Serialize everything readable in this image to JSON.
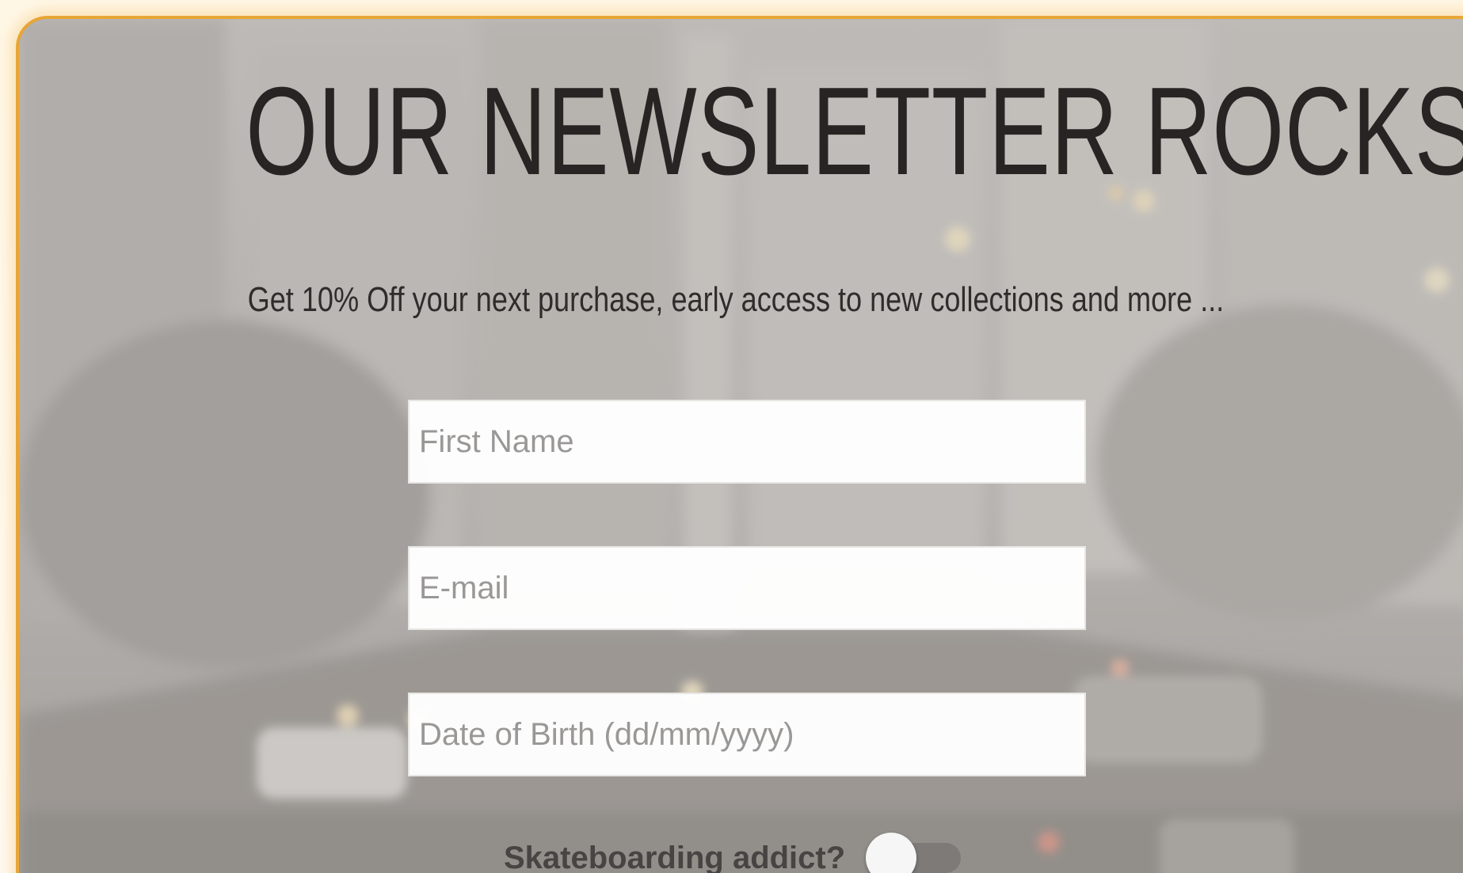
{
  "newsletter": {
    "headline": "OUR NEWSLETTER ROCKS!",
    "subtitle": "Get 10% Off your next purchase, early access to new collections and more ...",
    "fields": {
      "first_name_placeholder": "First Name",
      "email_placeholder": "E-mail",
      "dob_placeholder": "Date of Birth (dd/mm/yyyy)"
    },
    "toggle": {
      "label": "Skateboarding addict?",
      "checked": false
    }
  },
  "colors": {
    "card_border": "#e8a636",
    "page_background": "#fff6e4",
    "headline_text": "#272423",
    "toggle_track": "#7d7a78"
  },
  "background_image": "blurred-city-street-traffic-photo"
}
